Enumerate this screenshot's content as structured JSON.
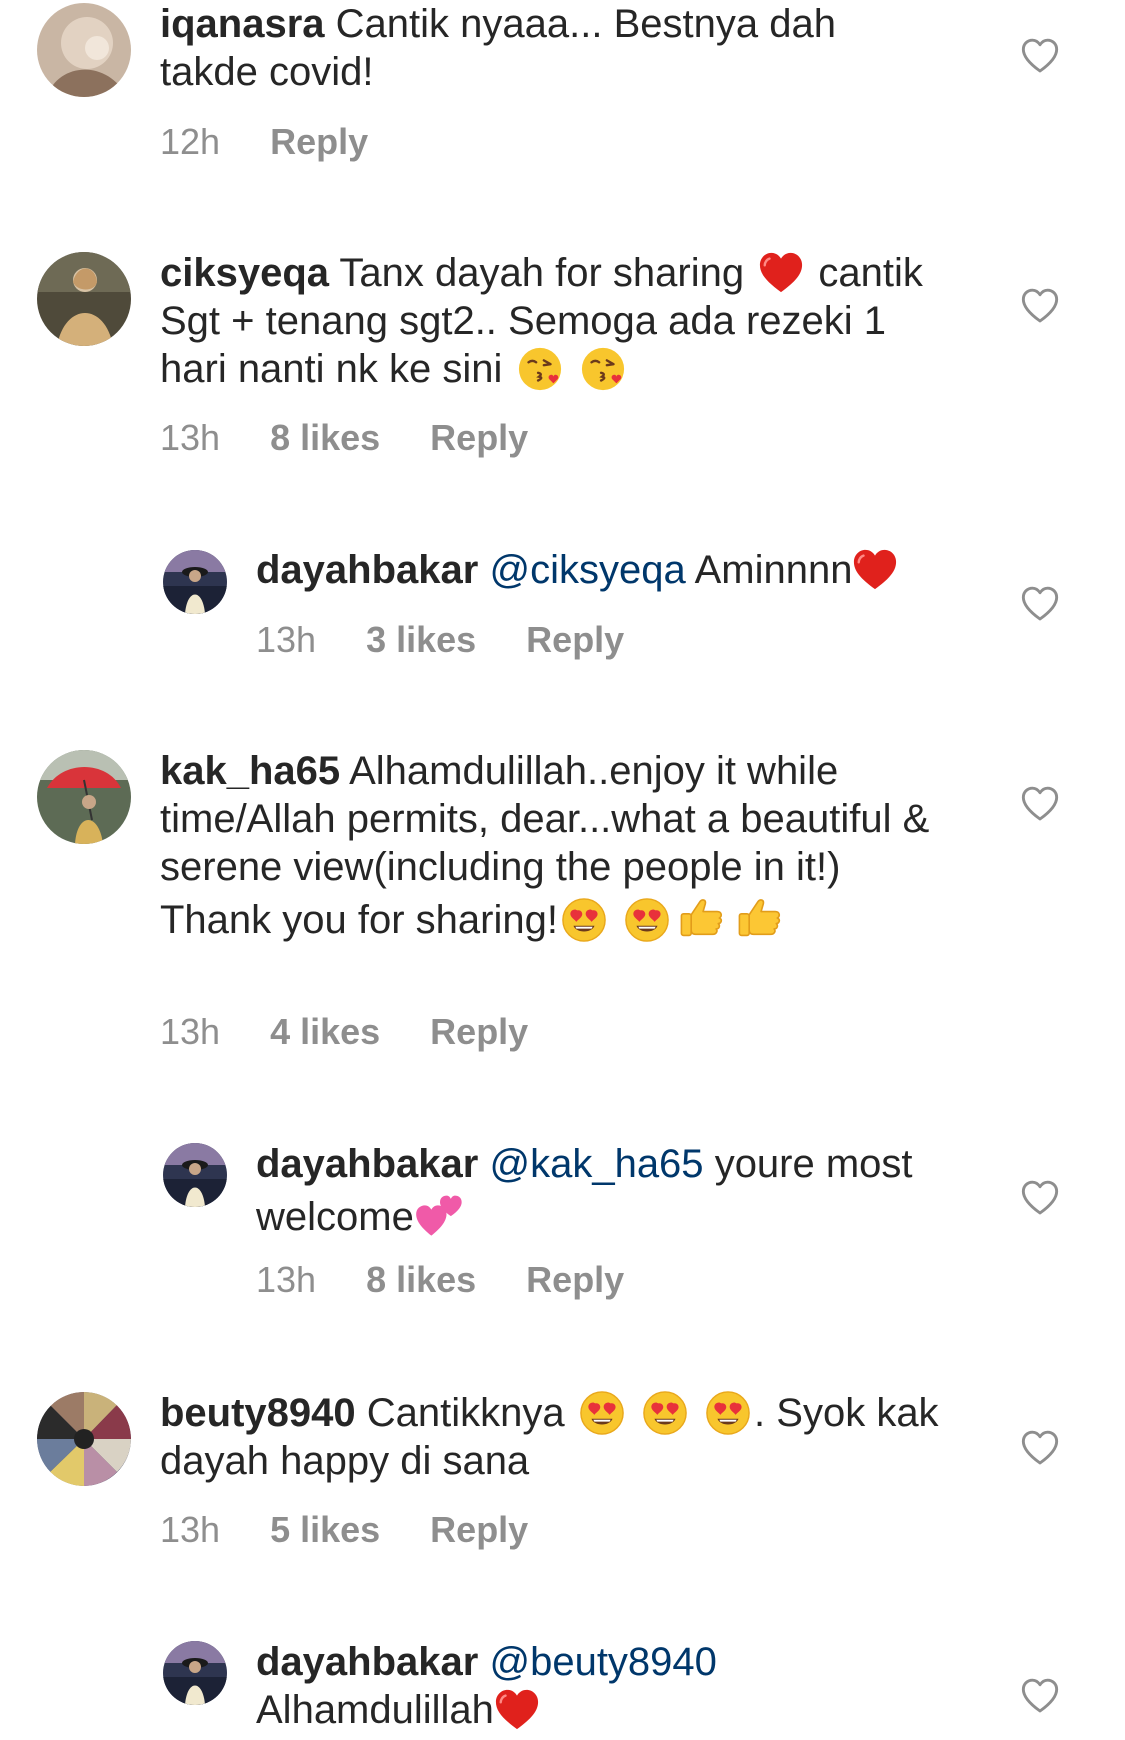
{
  "comments": [
    {
      "username": "iqanasra",
      "text": "Cantik nyaaa... Bestnya dah takde covid!",
      "time": "12h",
      "likes": "",
      "reply_label": "Reply"
    },
    {
      "username": "ciksyeqa",
      "text_part1": "Tanx dayah for sharing",
      "text_part2": "cantik Sgt + tenang sgt2.. Semoga ada rezeki 1 hari nanti nk ke sini",
      "time": "13h",
      "likes": "8 likes",
      "reply_label": "Reply"
    },
    {
      "username": "dayahbakar",
      "mention": "@ciksyeqa",
      "text": "Aminnnn",
      "time": "13h",
      "likes": "3 likes",
      "reply_label": "Reply"
    },
    {
      "username": "kak_ha65",
      "text": "Alhamdulillah..enjoy it while time/Allah permits, dear...what a beautiful & serene view(including the people in it!) Thank you for sharing!",
      "time": "13h",
      "likes": "4 likes",
      "reply_label": "Reply"
    },
    {
      "username": "dayahbakar",
      "mention": "@kak_ha65",
      "text": "youre most welcome",
      "time": "13h",
      "likes": "8 likes",
      "reply_label": "Reply"
    },
    {
      "username": "beuty8940",
      "text_part1": "Cantikknya",
      "text_part2": ". Syok kak dayah happy di sana",
      "time": "13h",
      "likes": "5 likes",
      "reply_label": "Reply"
    },
    {
      "username": "dayahbakar",
      "mention": "@beuty8940",
      "text": "Alhamdulillah",
      "time": "",
      "likes": "",
      "reply_label": ""
    }
  ],
  "icons": {
    "like": "heart-outline-icon"
  },
  "colors": {
    "text": "#262626",
    "secondary": "#8e8e8e",
    "mention": "#00376b",
    "heart_outline": "#8e8e8e"
  }
}
